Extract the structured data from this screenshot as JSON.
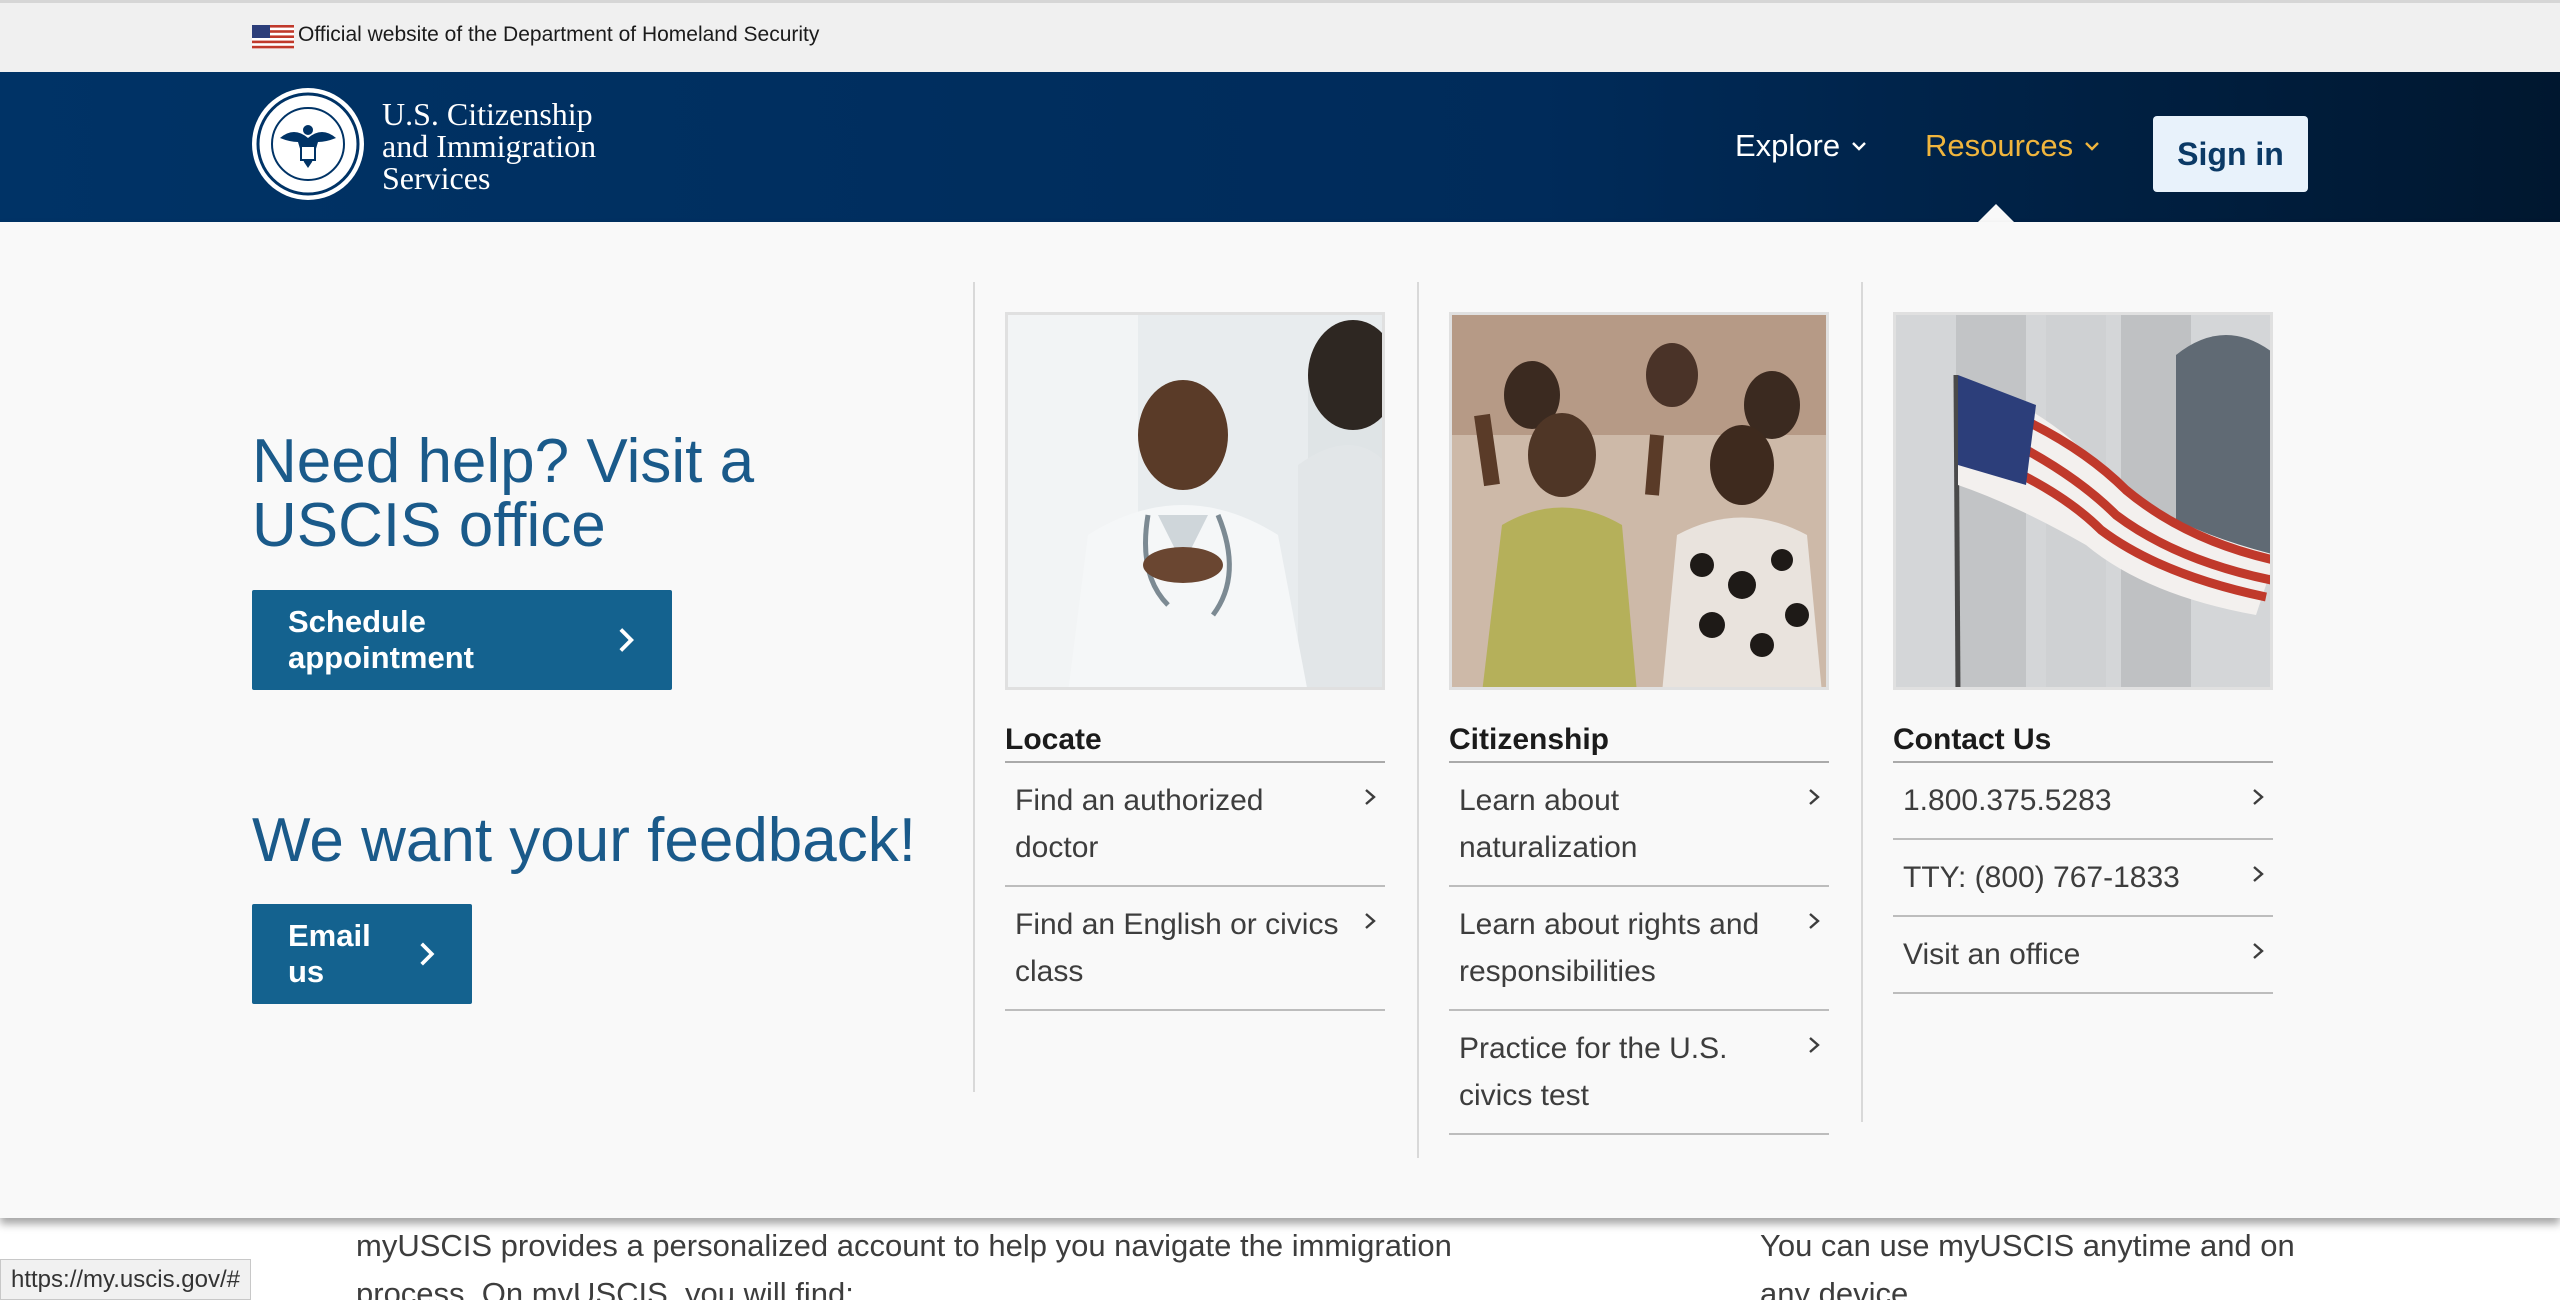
{
  "banner": {
    "text": "Official website of the Department of Homeland Security"
  },
  "header": {
    "brand_line1": "U.S. Citizenship",
    "brand_line2": "and Immigration",
    "brand_line3": "Services",
    "nav_explore": "Explore",
    "nav_resources": "Resources",
    "signin": "Sign in",
    "colors": {
      "header_bg": "#003366",
      "active_nav": "#f0b53d"
    }
  },
  "panel": {
    "help_heading": "Need help? Visit a USCIS office",
    "schedule_button": "Schedule appointment",
    "feedback_heading": "We want your feedback!",
    "email_button": "Email us",
    "columns": [
      {
        "title": "Locate",
        "image": "doctor-photo",
        "links": [
          "Find an authorized doctor",
          "Find an English or civics class"
        ]
      },
      {
        "title": "Citizenship",
        "image": "naturalization-ceremony-photo",
        "links": [
          "Learn about naturalization",
          "Learn about rights and responsibilities",
          "Practice for the U.S. civics test"
        ]
      },
      {
        "title": "Contact Us",
        "image": "american-flag-photo",
        "links": [
          "1.800.375.5283",
          "TTY: (800) 767-1833",
          "Visit an office"
        ]
      }
    ]
  },
  "page": {
    "intro_text": "myUSCIS provides a personalized account to help you navigate the immigration process. On myUSCIS, you will find:",
    "side_text": "You can use myUSCIS anytime and on any device."
  },
  "status_bar": {
    "url": "https://my.uscis.gov/#"
  }
}
